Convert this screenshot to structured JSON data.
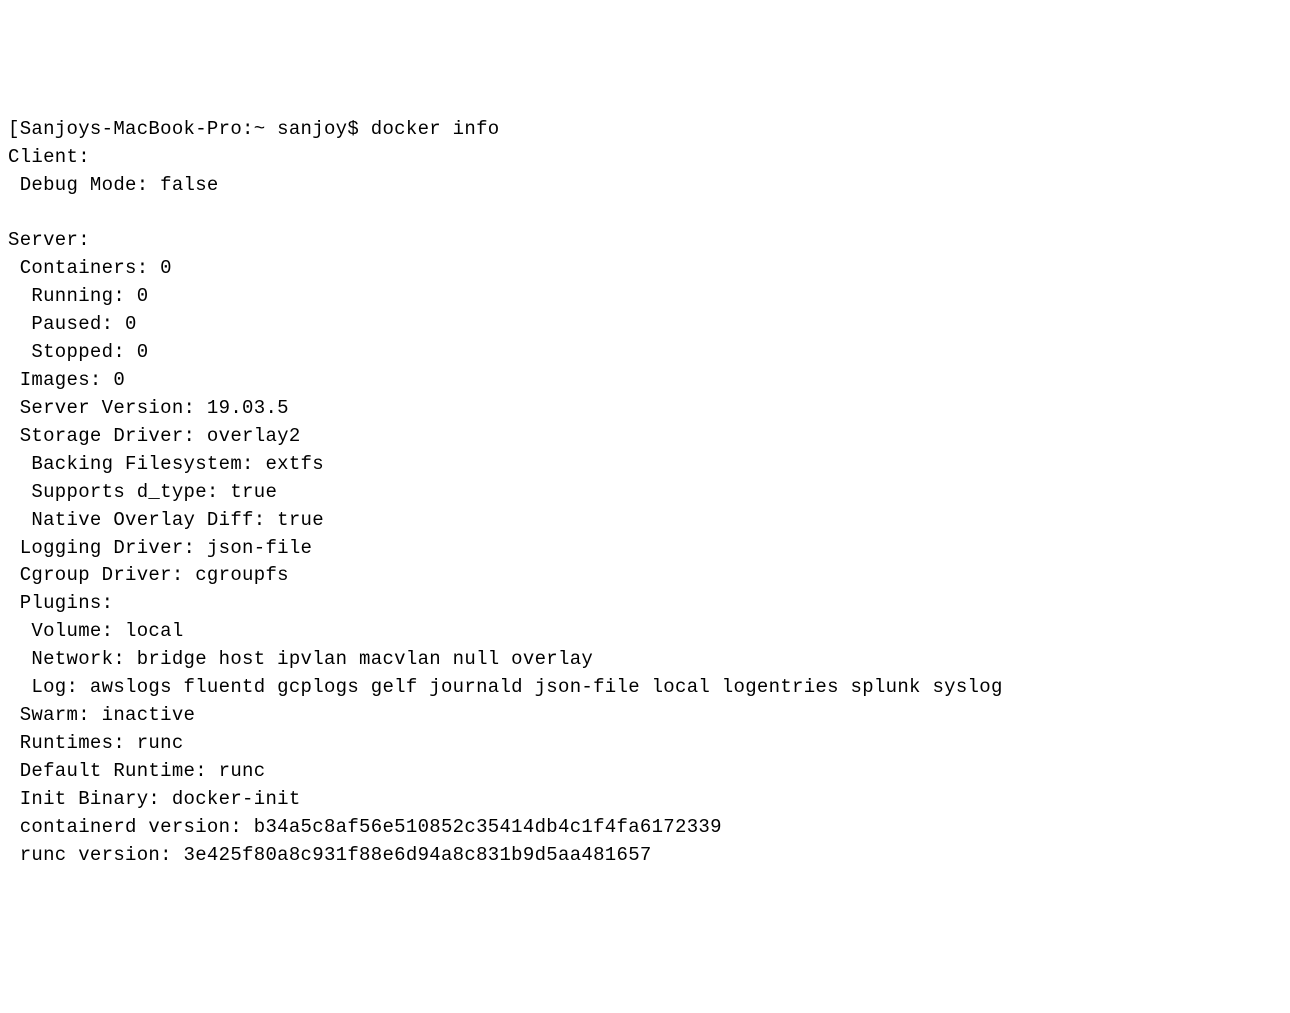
{
  "terminal": {
    "prompt_line": "[Sanjoys-MacBook-Pro:~ sanjoy$ docker info",
    "client_header": "Client:",
    "client_debug": " Debug Mode: false",
    "blank1": "",
    "server_header": "Server:",
    "server_containers": " Containers: 0",
    "server_running": "  Running: 0",
    "server_paused": "  Paused: 0",
    "server_stopped": "  Stopped: 0",
    "server_images": " Images: 0",
    "server_version": " Server Version: 19.03.5",
    "server_storage_driver": " Storage Driver: overlay2",
    "server_backing_fs": "  Backing Filesystem: extfs",
    "server_supports_dtype": "  Supports d_type: true",
    "server_native_overlay": "  Native Overlay Diff: true",
    "server_logging_driver": " Logging Driver: json-file",
    "server_cgroup_driver": " Cgroup Driver: cgroupfs",
    "server_plugins": " Plugins:",
    "server_plugins_volume": "  Volume: local",
    "server_plugins_network": "  Network: bridge host ipvlan macvlan null overlay",
    "server_plugins_log": "  Log: awslogs fluentd gcplogs gelf journald json-file local logentries splunk syslog",
    "server_swarm": " Swarm: inactive",
    "server_runtimes": " Runtimes: runc",
    "server_default_runtime": " Default Runtime: runc",
    "server_init_binary": " Init Binary: docker-init",
    "server_containerd_version": " containerd version: b34a5c8af56e510852c35414db4c1f4fa6172339",
    "server_runc_version": " runc version: 3e425f80a8c931f88e6d94a8c831b9d5aa481657"
  }
}
